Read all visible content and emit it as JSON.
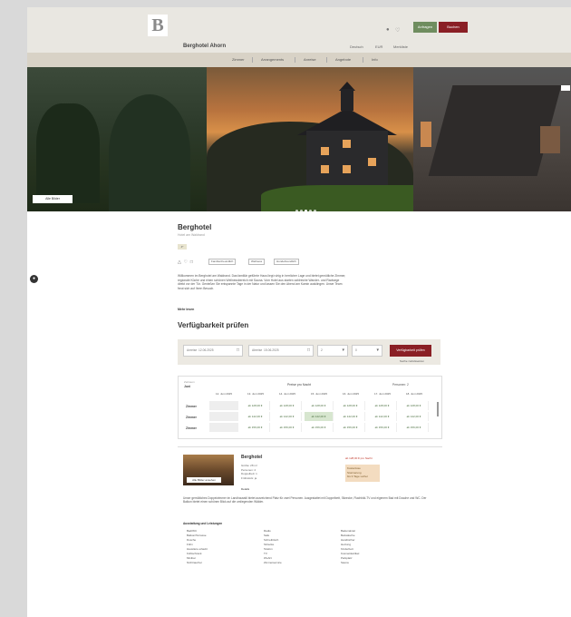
{
  "header": {
    "brand": "Berghotel Ahorn",
    "btn_green": "Anfragen",
    "btn_red": "Buchen",
    "links": [
      "Deutsch",
      "EUR",
      "Merkliste"
    ]
  },
  "nav": {
    "items": [
      "Zimmer",
      "Arrangements",
      "Anreise",
      "Angebote",
      "Info"
    ]
  },
  "hero": {
    "photos_button": "Alle Bilder"
  },
  "property": {
    "title": "Berghotel",
    "subtitle": "Hotel am Waldrand",
    "badge": "4*",
    "chips": [
      "Familienfreundlich",
      "Wellness",
      "Hundefreundlich"
    ],
    "description": "Willkommen im Berghotel am Waldrand. Das familiär geführte Haus liegt ruhig in herrlicher Lage und bietet gemütliche Zimmer, regionale Küche und einen schönen Wellnessbereich mit Sauna. Vom Hotel aus starten zahlreiche Wander- und Radwege direkt vor der Tür. Genießen Sie entspannte Tage in der Natur und lassen Sie den Abend am Kamin ausklingen. Unser Team freut sich auf Ihren Besuch.",
    "more_label": "Mehr lesen"
  },
  "availability": {
    "title": "Verfügbarkeit prüfen",
    "checkin_label": "Anreise",
    "checkin_value": "12.06.2025",
    "checkout_label": "Abreise",
    "checkout_value": "15.06.2025",
    "adults": "2",
    "children": "0",
    "search_button": "Verfügbarkeit prüfen",
    "reset_link": "Suche zurücksetzen"
  },
  "calendar": {
    "label": "Zeitraum",
    "sub": "Juni",
    "center": "Preise pro Nacht",
    "right": "Personen: 2",
    "columns": [
      "12. Juni 2025",
      "13. Juni 2025",
      "14. Juni 2025",
      "15. Juni 2025",
      "16. Juni 2025",
      "17. Juni 2025",
      "18. Juni 2025"
    ],
    "rows": [
      {
        "label": "Zimmer",
        "cells": [
          "",
          "ab 128,00 €",
          "ab 128,00 €",
          "ab 128,00 €",
          "ab 128,00 €",
          "ab 128,00 €",
          "ab 128,00 €"
        ]
      },
      {
        "label": "Zimmer",
        "cells": [
          "",
          "ab 142,00 €",
          "ab 142,00 €",
          "ab 142,00 €",
          "ab 142,00 €",
          "ab 142,00 €",
          "ab 142,00 €"
        ]
      },
      {
        "label": "Zimmer",
        "cells": [
          "",
          "ab 156,00 €",
          "ab 156,00 €",
          "ab 156,00 €",
          "ab 156,00 €",
          "ab 156,00 €",
          "ab 156,00 €"
        ]
      }
    ]
  },
  "room": {
    "image_button": "Alle Bilder ansehen",
    "title": "Berghotel",
    "specs": [
      "Größe: 28 m²",
      "Personen: 2",
      "Doppelbett: 1",
      "Frühstück: ja"
    ],
    "note": "Details",
    "price_label": "ab 128,00 € pro Nacht",
    "price_box": [
      "Kostenlose",
      "Stornierung",
      "bis 3 Tage vorher"
    ],
    "description": "Unser gemütliches Doppelzimmer im Landhausstil bietet ausreichend Platz für zwei Personen. Ausgestattet mit Doppelbett, Sitzecke, Flachbild-TV und eigenem Bad mit Dusche und WC. Der Balkon bietet einen schönen Blick auf die umliegenden Wälder.",
    "amenities_title": "Ausstattung und Leistungen",
    "amenities": [
      [
        "Bad/WC",
        "Balkon/Terrasse",
        "Dusche",
        "Föhn",
        "Haustiere erlaubt",
        "Kühlschrank",
        "Minibar",
        "Nichtraucher"
      ],
      [
        "Radio",
        "Safe",
        "Schreibtisch",
        "Sitzecke",
        "Telefon",
        "TV",
        "WLAN",
        "Zimmerservice"
      ],
      [
        "Bademäntel",
        "Bettwäsche",
        "Handtücher",
        "Heizung",
        "Kinderbett",
        "Kosmetikartikel",
        "Parkplatz",
        "Sauna"
      ]
    ]
  }
}
